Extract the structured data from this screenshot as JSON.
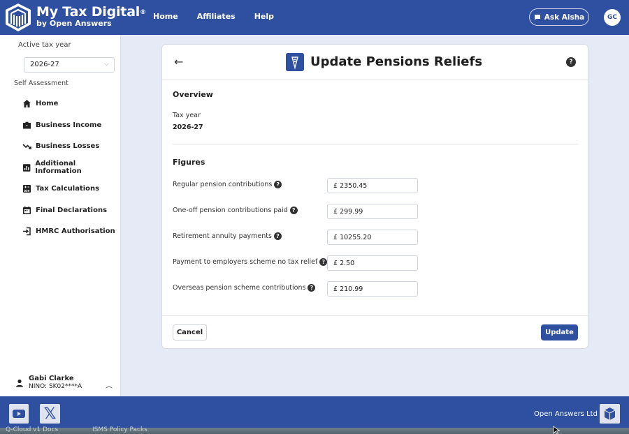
{
  "header": {
    "brand_name": "My Tax Digital",
    "brand_reg": "®",
    "brand_sub": "by Open Answers",
    "nav": [
      "Home",
      "Affiliates",
      "Help"
    ],
    "ask_label": "Ask Aisha",
    "avatar_initials": "GC"
  },
  "sidebar": {
    "tax_year_label": "Active tax year",
    "tax_year_value": "2026-27",
    "section_label": "Self Assessment",
    "items": [
      {
        "label": "Home",
        "icon": "home-icon"
      },
      {
        "label": "Business Income",
        "icon": "briefcase-icon"
      },
      {
        "label": "Business Losses",
        "icon": "trending-down-icon"
      },
      {
        "label": "Additional Information",
        "icon": "bar-chart-icon"
      },
      {
        "label": "Tax Calculations",
        "icon": "calculator-icon"
      },
      {
        "label": "Final Declarations",
        "icon": "calendar-icon"
      },
      {
        "label": "HMRC Authorisation",
        "icon": "login-icon"
      }
    ],
    "user_name": "Gabi Clarke",
    "user_nino": "NINO: SK02****A"
  },
  "card": {
    "title": "Update Pensions Reliefs",
    "overview_heading": "Overview",
    "tax_year_label": "Tax year",
    "tax_year_value": "2026-27",
    "figures_heading": "Figures",
    "fields": [
      {
        "label": "Regular pension contributions",
        "value": "£ 2350.45"
      },
      {
        "label": "One-off pension contributions paid",
        "value": "£ 299.99"
      },
      {
        "label": "Retirement annuity payments",
        "value": "£ 10255.20"
      },
      {
        "label": "Payment to employers scheme no tax relief",
        "value": "£ 2.50"
      },
      {
        "label": "Overseas pension scheme contributions",
        "value": "£ 210.99"
      }
    ],
    "cancel_label": "Cancel",
    "update_label": "Update"
  },
  "footer": {
    "company": "Open Answers Ltd",
    "background_text": [
      "Q-Cloud v1 Docs",
      "ISMS Policy Packs"
    ]
  },
  "colors": {
    "brand": "#2f4fa0"
  }
}
